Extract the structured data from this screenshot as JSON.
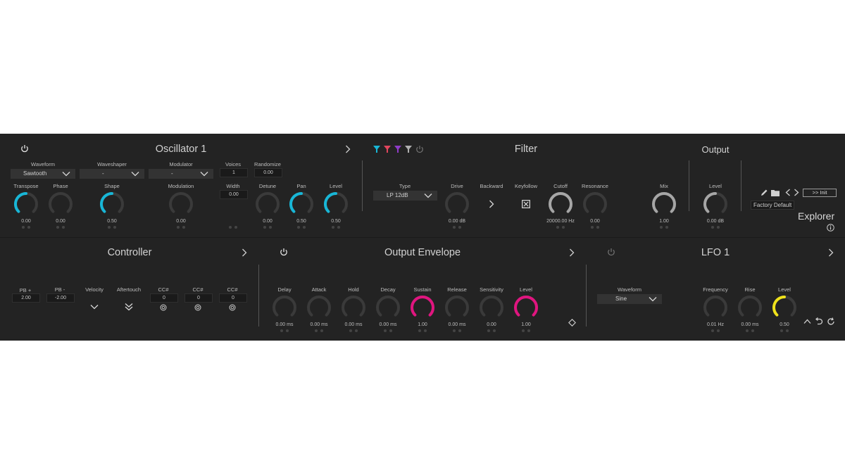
{
  "colors": {
    "cyan": "#18b6d6",
    "magenta": "#e0157f",
    "yellow": "#efe21b",
    "gray": "#a6a6a6",
    "track": "#3a3a3a",
    "purple": "#8f3bc8",
    "red": "#e0455c"
  },
  "oscillator": {
    "title": "Oscillator 1",
    "waveform": {
      "label": "Waveform",
      "value": "Sawtooth"
    },
    "waveshaper": {
      "label": "Waveshaper",
      "value": "-"
    },
    "modulator": {
      "label": "Modulator",
      "value": "-"
    },
    "voices": {
      "label": "Voices",
      "value": "1"
    },
    "randomize": {
      "label": "Randomize",
      "value": "0.00"
    },
    "width": {
      "label": "Width",
      "value": "0.00"
    },
    "knobs": [
      {
        "label": "Transpose",
        "value": "0.00",
        "fraction": 0.5,
        "color": "cyan"
      },
      {
        "label": "Phase",
        "value": "0.00",
        "fraction": 0,
        "color": "gray"
      },
      {
        "label": "Shape",
        "value": "0.50",
        "fraction": 0.5,
        "color": "cyan"
      },
      {
        "label": "Modulation",
        "value": "0.00",
        "fraction": 0,
        "color": "gray"
      },
      {
        "label": "Detune",
        "value": "0.00",
        "fraction": 0,
        "color": "gray"
      },
      {
        "label": "Pan",
        "value": "0.50",
        "fraction": 0.5,
        "color": "cyan"
      },
      {
        "label": "Level",
        "value": "0.50",
        "fraction": 0.5,
        "color": "cyan"
      }
    ]
  },
  "filter": {
    "title": "Filter",
    "type": {
      "label": "Type",
      "value": "LP 12dB"
    },
    "backward_label": "Backward",
    "keyfollow_label": "Keyfollow",
    "knobs": [
      {
        "label": "Drive",
        "value": "0.00 dB",
        "fraction": 0,
        "color": "gray"
      },
      {
        "label": "Cutoff",
        "value": "20000.00 Hz",
        "fraction": 1,
        "color": "gray"
      },
      {
        "label": "Resonance",
        "value": "0.00",
        "fraction": 0,
        "color": "gray"
      },
      {
        "label": "Mix",
        "value": "1.00",
        "fraction": 1,
        "color": "gray"
      }
    ]
  },
  "output": {
    "title": "Output",
    "knob": {
      "label": "Level",
      "value": "0.00 dB",
      "fraction": 0.5,
      "color": "gray"
    }
  },
  "explorer": {
    "title": "Explorer",
    "preset": "Factory Default",
    "init_label": ">> Init"
  },
  "controller": {
    "title": "Controller",
    "pb_plus": {
      "label": "PB +",
      "value": "2.00"
    },
    "pb_minus": {
      "label": "PB -",
      "value": "-2.00"
    },
    "velocity_label": "Velocity",
    "aftertouch_label": "Aftertouch",
    "cc": [
      {
        "label": "CC#",
        "value": "0"
      },
      {
        "label": "CC#",
        "value": "0"
      },
      {
        "label": "CC#",
        "value": "0"
      }
    ]
  },
  "envelope": {
    "title": "Output Envelope",
    "knobs": [
      {
        "label": "Delay",
        "value": "0.00 ms",
        "fraction": 0,
        "color": "gray"
      },
      {
        "label": "Attack",
        "value": "0.00 ms",
        "fraction": 0,
        "color": "gray"
      },
      {
        "label": "Hold",
        "value": "0.00 ms",
        "fraction": 0,
        "color": "gray"
      },
      {
        "label": "Decay",
        "value": "0.00 ms",
        "fraction": 0,
        "color": "gray"
      },
      {
        "label": "Sustain",
        "value": "1.00",
        "fraction": 1,
        "color": "magenta"
      },
      {
        "label": "Release",
        "value": "0.00 ms",
        "fraction": 0,
        "color": "gray"
      },
      {
        "label": "Sensitivity",
        "value": "0.00",
        "fraction": 0,
        "color": "gray"
      },
      {
        "label": "Level",
        "value": "1.00",
        "fraction": 1,
        "color": "magenta"
      }
    ]
  },
  "lfo": {
    "title": "LFO 1",
    "waveform": {
      "label": "Waveform",
      "value": "Sine"
    },
    "knobs": [
      {
        "label": "Frequency",
        "value": "0.01 Hz",
        "fraction": 0,
        "color": "gray"
      },
      {
        "label": "Rise",
        "value": "0.00 ms",
        "fraction": 0,
        "color": "gray"
      },
      {
        "label": "Level",
        "value": "0.50",
        "fraction": 0.5,
        "color": "yellow"
      }
    ]
  }
}
